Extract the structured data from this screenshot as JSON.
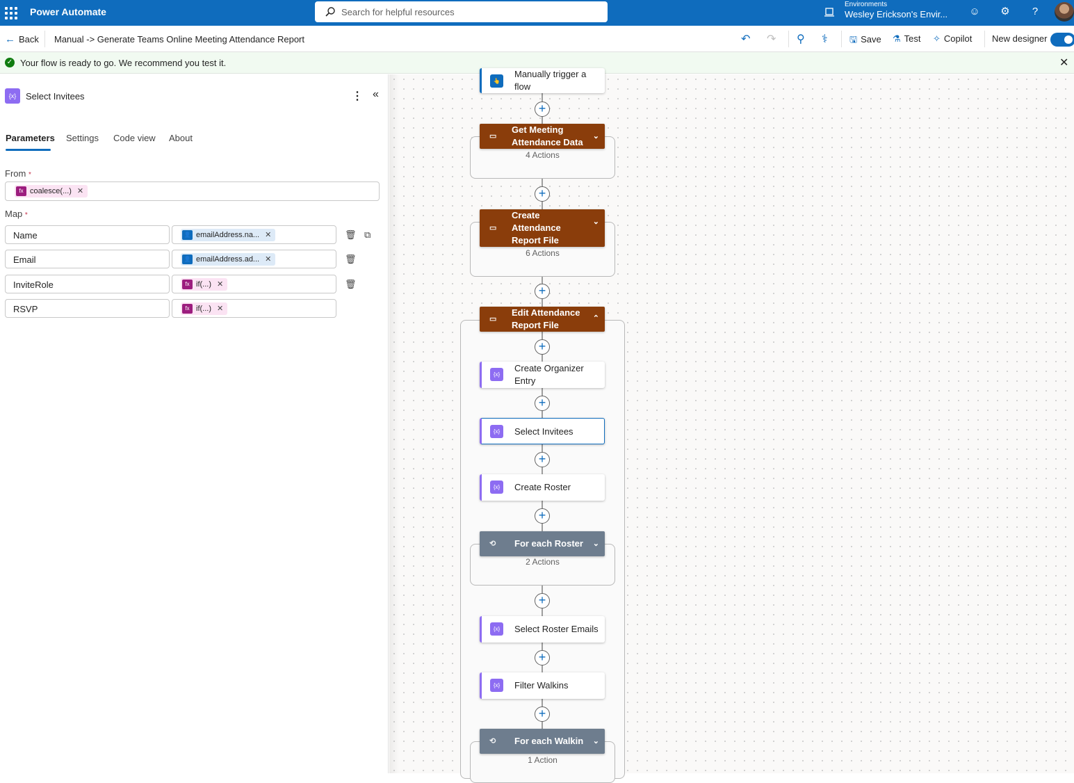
{
  "topbar": {
    "brand": "Power Automate",
    "search_placeholder": "Search for helpful resources",
    "env_label": "Environments",
    "env_name": "Wesley Erickson's Envir..."
  },
  "cmdbar": {
    "back": "Back",
    "breadcrumb": "Manual -> Generate Teams Online Meeting Attendance Report",
    "save": "Save",
    "test": "Test",
    "copilot": "Copilot",
    "new_designer": "New designer"
  },
  "message": {
    "text": "Your flow is ready to go. We recommend you test it."
  },
  "panel": {
    "title": "Select Invitees",
    "tabs": [
      "Parameters",
      "Settings",
      "Code view",
      "About"
    ],
    "from_label": "From",
    "from_token": "coalesce(...)",
    "map_label": "Map",
    "required_mark": "*",
    "map_rows": [
      {
        "key": "Name",
        "token": "emailAddress.na...",
        "token_type": "dynamic"
      },
      {
        "key": "Email",
        "token": "emailAddress.ad...",
        "token_type": "dynamic"
      },
      {
        "key": "InviteRole",
        "token": "if(...)",
        "token_type": "expression"
      },
      {
        "key": "RSVP",
        "token": "if(...)",
        "token_type": "expression"
      }
    ]
  },
  "flow": {
    "trigger": "Manually trigger a flow",
    "get_meeting": {
      "title": "Get Meeting Attendance Data",
      "sub": "4 Actions"
    },
    "create_report": {
      "title": "Create Attendance Report File",
      "sub": "6 Actions"
    },
    "edit_report": {
      "title": "Edit Attendance Report File"
    },
    "create_organizer": "Create Organizer Entry",
    "select_invitees": "Select Invitees",
    "create_roster": "Create Roster",
    "foreach_roster": {
      "title": "For each Roster",
      "sub": "2 Actions"
    },
    "select_roster_emails": "Select Roster Emails",
    "filter_walkins": "Filter Walkins",
    "foreach_walkin": {
      "title": "For each Walkin",
      "sub": "1 Action"
    }
  },
  "colors": {
    "brand_blue": "#0f6cbd",
    "scope_brown": "#8a3d0b",
    "loop_gray": "#6e7d8e",
    "data_op_purple": "#8d6cf2"
  }
}
